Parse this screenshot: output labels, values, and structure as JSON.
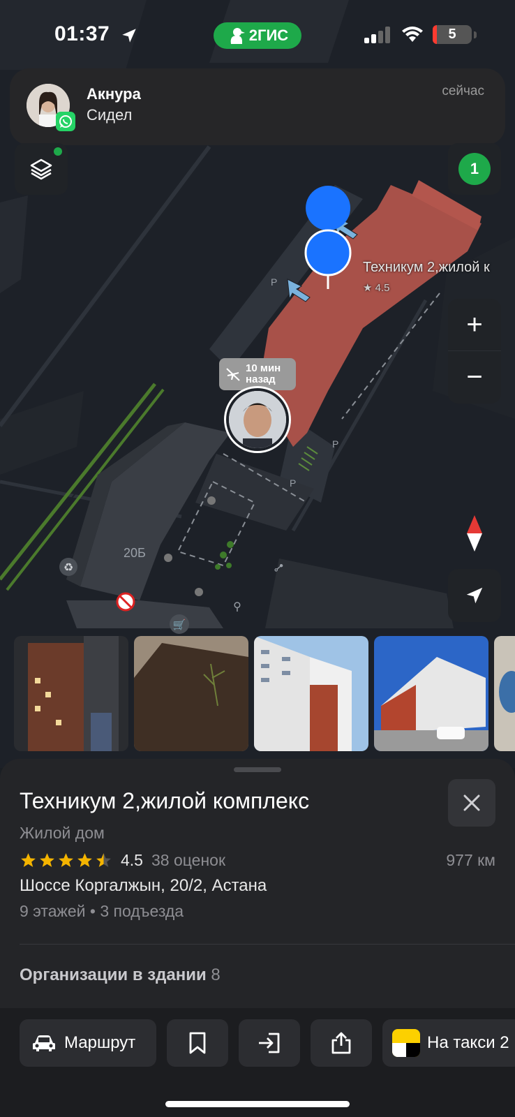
{
  "status_bar": {
    "time": "01:37",
    "app_badge": "2ГИС",
    "battery": "5"
  },
  "notification": {
    "sender": "Акнура",
    "message": "Сидел",
    "time": "сейчас",
    "app_icon": "whatsapp-icon"
  },
  "map": {
    "friends_count": "1",
    "building_label": "Техникум 2,жилой к",
    "building_rating": "★ 4.5",
    "house_number": "20Б",
    "parking_symbol": "P",
    "friend_marker": {
      "time_ago": "10 мин назад",
      "time_ago_line1": "10 мин",
      "time_ago_line2": "назад"
    },
    "zoom_in": "+",
    "zoom_out": "−"
  },
  "photos": {
    "count_visible": 5
  },
  "place": {
    "title": "Техникум 2,жилой комплекс",
    "type": "Жилой дом",
    "rating": "4.5",
    "rating_stars": 4.5,
    "rating_count": "38 оценок",
    "distance": "977 км",
    "address": "Шоссе Коргалжын, 20/2, Астана",
    "floors": "9 этажей • 3 подъезда",
    "organizations_label": "Организации в здании",
    "organizations_count": "8"
  },
  "actions": {
    "route": "Маршрут",
    "taxi": "На такси 2"
  },
  "colors": {
    "brand_green": "#1ea94a",
    "accent_blue": "#1a73ff",
    "building_red": "#a85149",
    "sheet_bg": "#242528",
    "star": "#f4b400"
  }
}
